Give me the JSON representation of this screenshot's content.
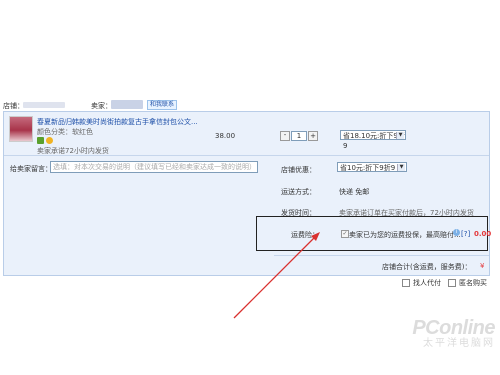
{
  "shop_label": "店铺：",
  "seller_label": "卖家：",
  "seller_badge": "和我联系",
  "product": {
    "title": "春夏新品归韩款美时尚街拍款复古手拿信封包公文...",
    "color_label": "颜色分类：",
    "color_value": "软红色",
    "promise": "卖家承诺72小时内发货",
    "price": "38.00",
    "quantity": "1",
    "discount_select": "省18.10元:折下9折9"
  },
  "message": {
    "label": "给卖家留言：",
    "placeholder": "选填：对本次交易的说明（建议填写已经和卖家达成一致的说明）"
  },
  "shop_discount": {
    "label": "店铺优惠：",
    "value": "省10元:折下9折9"
  },
  "shipping": {
    "label": "运送方式：",
    "value": "快递 免邮"
  },
  "ship_time": {
    "label": "发货时间：",
    "value": "卖家承诺订单在买家付款后，72小时内发货"
  },
  "insurance": {
    "label": "运费险：",
    "text": "卖家已为您的运费投保，最高赔付...",
    "help": "[?]",
    "amount": "0.00"
  },
  "total": {
    "label": "店铺合计(含运费，服务费)：",
    "currency": "¥"
  },
  "options": {
    "other_pay": "找人代付",
    "anonymous": "匿名购买"
  },
  "watermark": {
    "brand": "PConline",
    "chinese": "太平洋电脑网"
  },
  "colors": {
    "price_red": "#e4393c",
    "link_blue": "#1d4fa8",
    "arrow_red": "#d9312f"
  }
}
